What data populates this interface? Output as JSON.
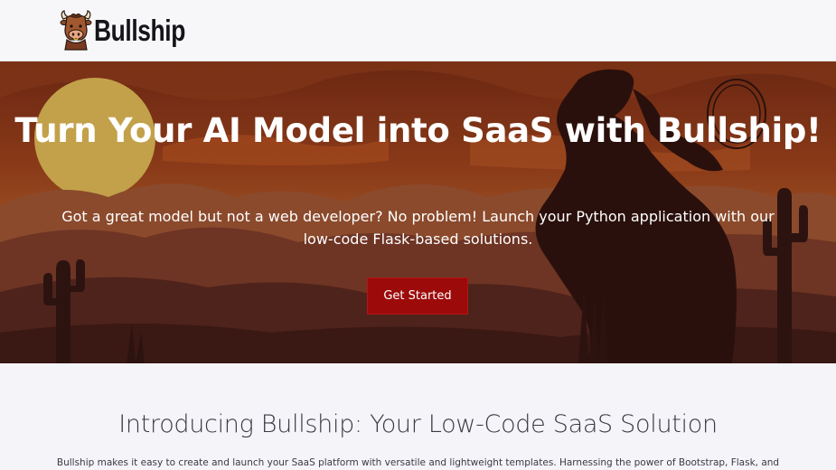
{
  "navbar": {
    "brand_name": "Bullship",
    "logo_icon": "bull-logo-icon"
  },
  "hero": {
    "title": "Turn Your AI Model into SaaS with Bullship!",
    "subtitle": "Got a great model but not a web developer? No problem! Launch your Python application with our low-code Flask-based solutions.",
    "button_label": "Get Started",
    "button_color": "#9c0a0a",
    "background": "desert-sunset-cowboy-illustration"
  },
  "intro": {
    "title": "Introducing Bullship: Your Low-Code SaaS Solution",
    "text": "Bullship makes it easy to create and launch your SaaS platform with versatile and lightweight templates. Harnessing the power of Bootstrap, Flask, and"
  },
  "colors": {
    "accent": "#9c0a0a",
    "sky_dark": "#6e2a13",
    "sun": "#c9a24a",
    "page_bg": "#f5f4f9"
  }
}
